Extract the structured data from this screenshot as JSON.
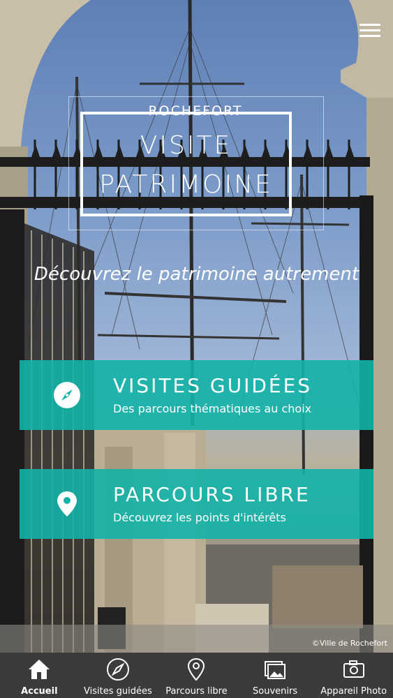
{
  "header": {
    "menu_icon": "hamburger-menu-icon"
  },
  "logo": {
    "city": "ROCHEFORT",
    "line1": "VISITE",
    "line2": "PATRIMOINE"
  },
  "tagline": "Découvrez le patrimoine autrement",
  "cards": [
    {
      "icon": "compass-icon",
      "title": "VISITES GUIDÉES",
      "subtitle": "Des parcours thématiques au choix"
    },
    {
      "icon": "map-pin-icon",
      "title": "PARCOURS LIBRE",
      "subtitle": "Découvrez les points d'intérêts"
    }
  ],
  "credit": "©Ville de Rochefort",
  "tabs": [
    {
      "label": "Accueil",
      "icon": "home-icon",
      "active": true
    },
    {
      "label": "Visites guidées",
      "icon": "compass-icon",
      "active": false
    },
    {
      "label": "Parcours libre",
      "icon": "map-pin-icon",
      "active": false
    },
    {
      "label": "Souvenirs",
      "icon": "photos-icon",
      "active": false
    },
    {
      "label": "Appareil Photo",
      "icon": "camera-icon",
      "active": false
    }
  ],
  "colors": {
    "accent": "#12b2a8",
    "tabbar": "#3b3b3b"
  }
}
